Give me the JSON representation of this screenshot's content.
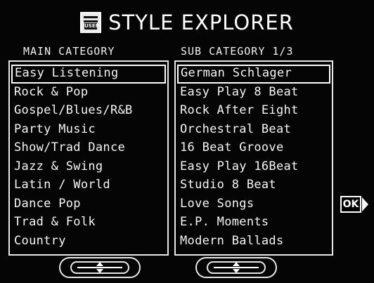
{
  "title": {
    "text": "STYLE EXPLORER",
    "icon": "keyboard-style-icon",
    "icon_label": "USER"
  },
  "main_category": {
    "header": "MAIN CATEGORY",
    "items": [
      "Easy Listening",
      "Rock & Pop",
      "Gospel/Blues/R&B",
      "Party Music",
      "Show/Trad Dance",
      "Jazz & Swing",
      "Latin / World",
      "Dance Pop",
      "Trad & Folk",
      "Country"
    ],
    "selected_index": 0
  },
  "sub_category": {
    "header": "SUB CATEGORY 1/3",
    "items": [
      "German Schlager",
      "Easy Play 8 Beat",
      "Rock After Eight",
      "Orchestral Beat",
      "16 Beat Groove",
      "Easy Play 16Beat",
      "Studio 8 Beat",
      "Love Songs",
      "E.P. Moments",
      "Modern Ballads"
    ],
    "selected_index": 0
  },
  "buttons": {
    "ok_label": "OK",
    "scroll_icon": "up-down-arrows-icon"
  }
}
